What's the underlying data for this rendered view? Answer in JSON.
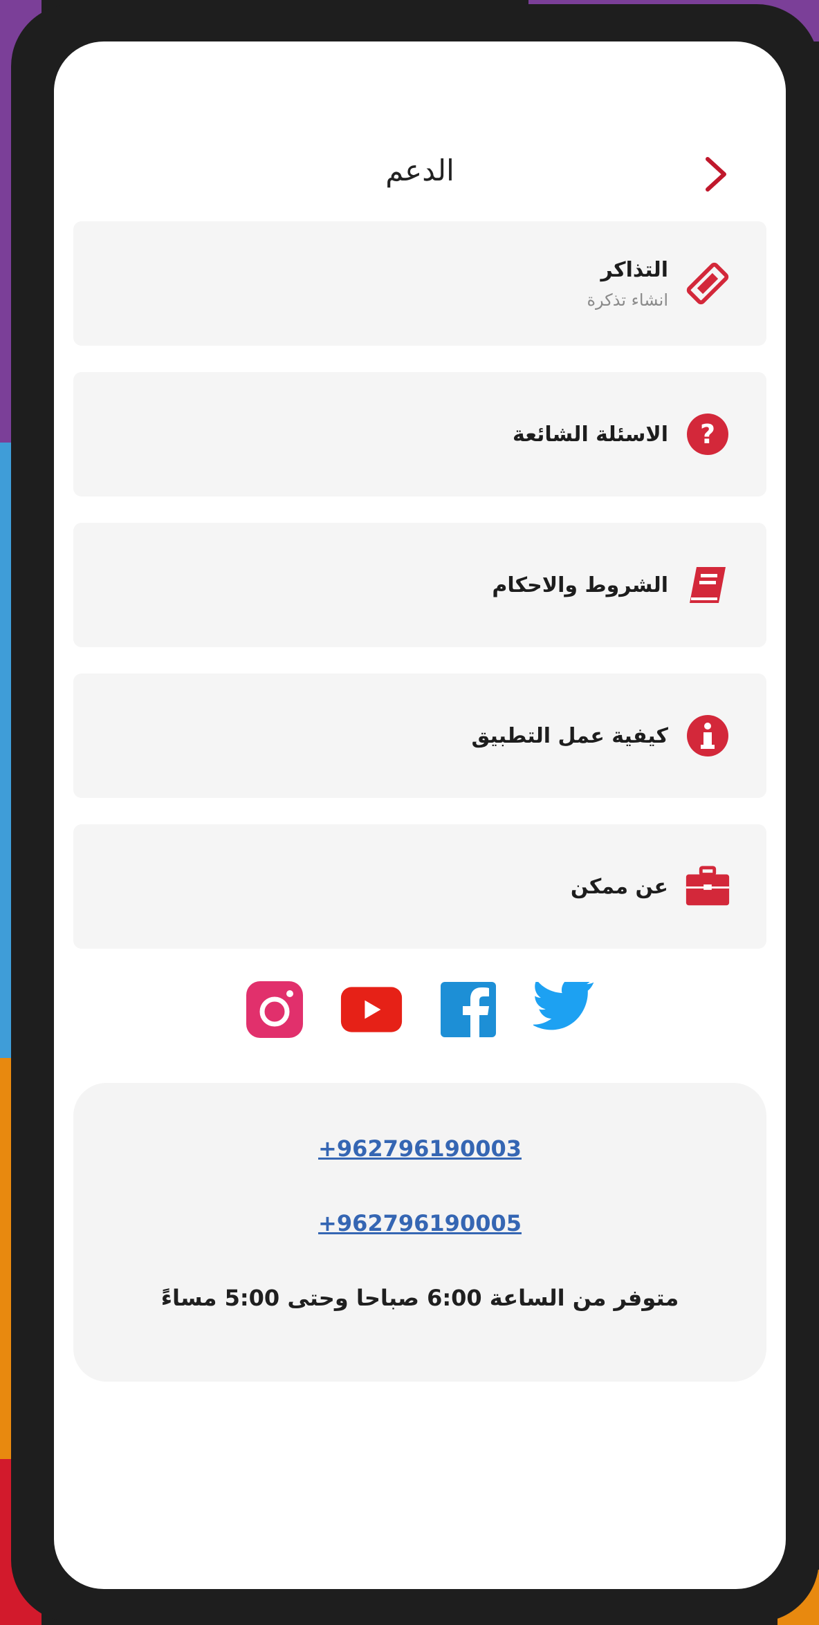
{
  "header": {
    "title": "الدعم"
  },
  "menu": [
    {
      "label": "التذاكر",
      "sub": "انشاء تذكرة",
      "icon": "ticket-icon"
    },
    {
      "label": "الاسئلة الشائعة",
      "icon": "question-circle-icon"
    },
    {
      "label": "الشروط والاحكام",
      "icon": "book-icon"
    },
    {
      "label": "كيفية عمل التطبيق",
      "icon": "info-circle-icon"
    },
    {
      "label": "عن ممكن",
      "icon": "briefcase-icon"
    }
  ],
  "social": [
    {
      "name": "instagram-icon",
      "color": "#e1306c"
    },
    {
      "name": "youtube-icon",
      "color": "#e62117"
    },
    {
      "name": "facebook-icon",
      "color": "#1d8fd6"
    },
    {
      "name": "twitter-icon",
      "color": "#1da1f2"
    }
  ],
  "contact": {
    "phone1": "+962796190003",
    "phone2": "+962796190005",
    "hours": "متوفر من الساعة 6:00 صباحا وحتى 5:00 مساءً"
  },
  "colors": {
    "accent": "#d3283a",
    "link": "#3566b3"
  }
}
